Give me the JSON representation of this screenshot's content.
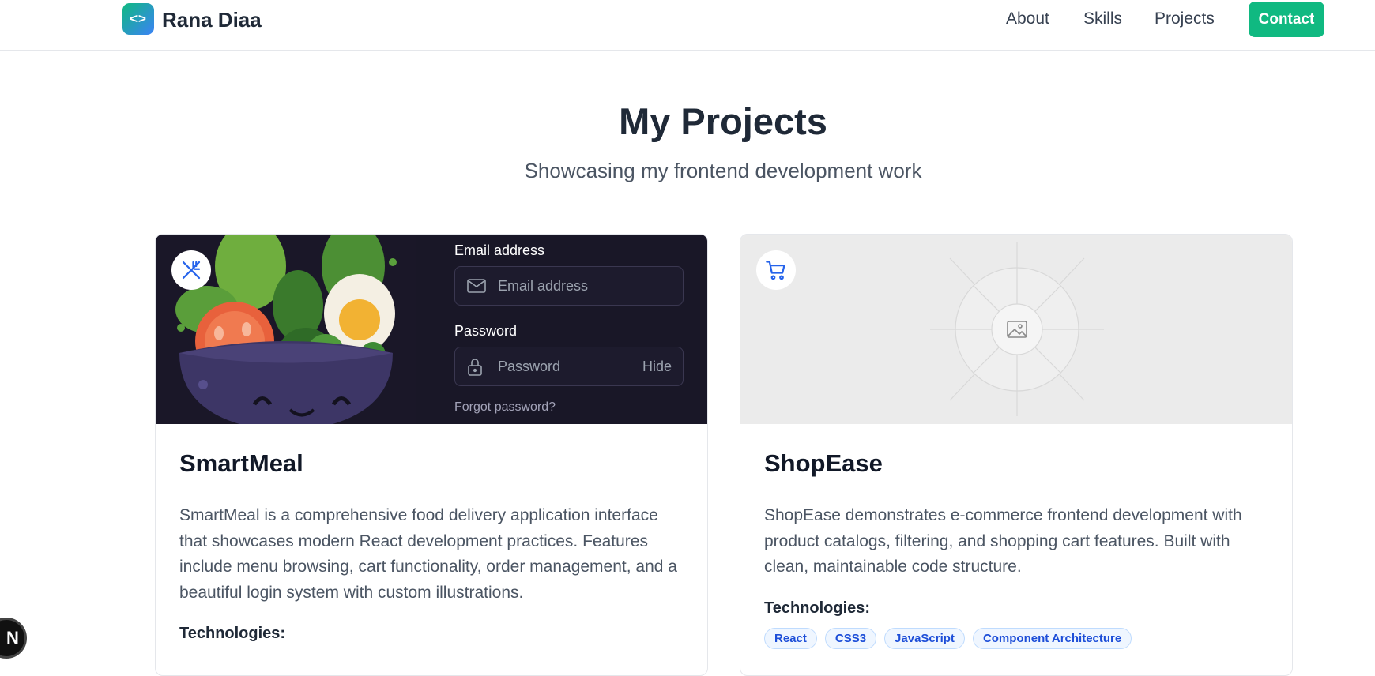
{
  "nav": {
    "logo_glyph": "<>",
    "brand": "Rana Diaa",
    "links": [
      "About",
      "Skills",
      "Projects"
    ],
    "contact_label": "Contact"
  },
  "section": {
    "title": "My Projects",
    "subtitle": "Showcasing my frontend development work"
  },
  "projects": [
    {
      "title": "SmartMeal",
      "icon": "fork-knife-icon",
      "image": {
        "email_label": "Email address",
        "email_placeholder": "Email address",
        "password_label": "Password",
        "password_placeholder": "Password",
        "hide_label": "Hide",
        "forgot_label": "Forgot password?"
      },
      "description": "SmartMeal is a comprehensive food delivery application interface that showcases modern React development practices. Features include menu browsing, cart functionality, order management, and a beautiful login system with custom illustrations.",
      "tech_label": "Technologies:"
    },
    {
      "title": "ShopEase",
      "icon": "shopping-cart-icon",
      "description": "ShopEase demonstrates e-commerce frontend development with product catalogs, filtering, and shopping cart features. Built with clean, maintainable code structure.",
      "tech_label": "Technologies:",
      "tags": [
        "React",
        "CSS3",
        "JavaScript",
        "Component Architecture"
      ]
    }
  ],
  "dev_badge": "N",
  "colors": {
    "accent": "#10b981",
    "tag_text": "#1d4ed8",
    "tag_bg": "#eff6ff",
    "dark_panel": "#1a1728"
  }
}
